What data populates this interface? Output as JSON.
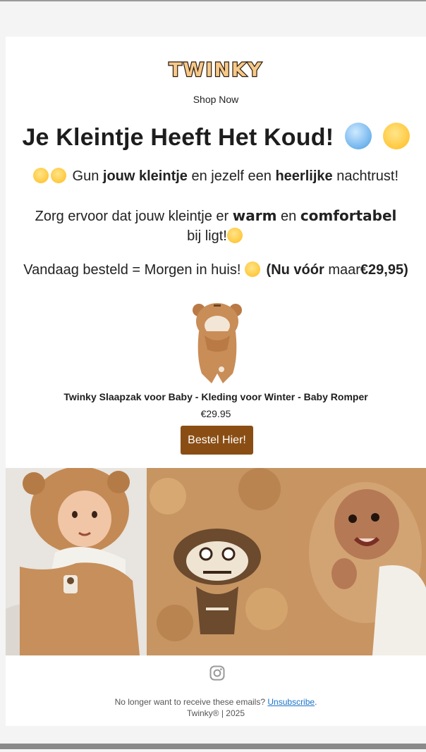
{
  "brand": {
    "logo_text": "TWINKY"
  },
  "header": {
    "shop_now": "Shop Now"
  },
  "headline": {
    "title": "Je Kleintje Heeft Het Koud!"
  },
  "body": {
    "line1_pre": "Gun",
    "line1_bold1": "jouw kleintje",
    "line1_mid": "en jezelf een",
    "line1_bold2": "heerlijke",
    "line1_post": "nachtrust!",
    "line2_pre": "Zorg ervoor dat jouw kleintje er",
    "line2_bold1": "warm",
    "line2_mid": "en",
    "line2_bold2": "comfortabel",
    "line2_post": "bij ligt!",
    "line3_pre": "Vandaag besteld = Morgen in huis!",
    "line3_bold1": "(Nu vóór",
    "line3_mid": "maar",
    "line3_bold2": "€29,95)"
  },
  "product": {
    "title": "Twinky Slaapzak voor Baby - Kleding voor Winter - Baby Romper",
    "price": "€29.95",
    "cta_label": "Bestel Hier!"
  },
  "footer": {
    "unsubscribe_pre": "No longer want to receive these emails?",
    "unsubscribe_link": "Unsubscribe",
    "unsubscribe_post": ".",
    "copyright": "Twinky® | 2025"
  },
  "icons": {
    "social": "instagram-icon"
  },
  "colors": {
    "cta": "#8a4e14",
    "link": "#1a73c9",
    "fleece": "#c98d57"
  }
}
